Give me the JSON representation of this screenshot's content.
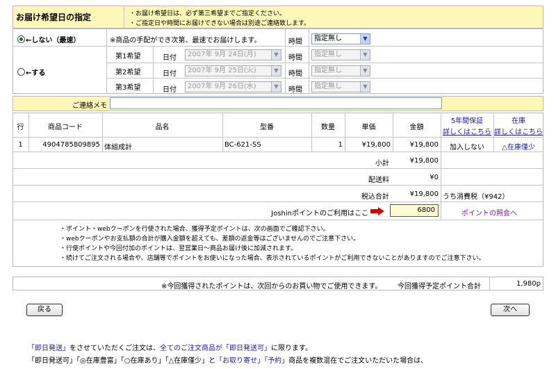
{
  "delivery": {
    "title": "お届け希望日の指定",
    "notes": [
      "・お届け希望日は、必ず第三希望までご指定ください。",
      "・ご指定日や時間にお届けできない場合は別途ご連絡致します。"
    ],
    "option_fastest_label": "←しない（最速）",
    "option_fastest_note": "※商品の手配ができ次第、最速でお届けします。",
    "option_specify_label": "←する",
    "time_label": "時間",
    "time_default": "指定無し",
    "date_label": "日付",
    "wishes": [
      {
        "label": "第1希望",
        "date": "2007年 9月 24日(月)"
      },
      {
        "label": "第2希望",
        "date": "2007年 9月 25日(火)"
      },
      {
        "label": "第3希望",
        "date": "2007年 9月 26日(水)"
      }
    ],
    "memo_label": "ご連絡メモ"
  },
  "table": {
    "headers": {
      "row": "行",
      "code": "商品コード",
      "name": "品名",
      "model": "型番",
      "qty": "数量",
      "price": "単価",
      "amount": "金額",
      "warranty_top": "5年間保証",
      "warranty_link": "詳しくはこちら",
      "stock_top": "在庫",
      "stock_link": "詳しくはこちら"
    },
    "row": {
      "no": "1",
      "code": "4904785809895",
      "name": "体組成計",
      "model": "BC-621-SS",
      "qty": "1",
      "price": "¥19,800",
      "amount": "¥19,800",
      "warranty": "加入しない",
      "stock": "△在庫僅少"
    },
    "subtotal_label": "小計",
    "subtotal": "¥19,800",
    "shipping_label": "配送料",
    "shipping": "¥0",
    "total_label": "税込合計",
    "total": "¥19,800",
    "tax_note": "うち消費税（¥942）",
    "points_label": "Joshinポイントのご利用はここ",
    "points_value": "6800",
    "points_link": "ポイントの照会へ"
  },
  "point_notes": [
    "・ポイント・webクーポンを行使された場合、獲得予定ポイントは、次の画面でご確認下さい。",
    "・webクーポンやお支払額の合計が購入金額を超えても、差額の返金等はございませんのでご注意下さい。",
    "・行使ポイントや今回付加のポイントは、翌営業日～商品お届け後に加減されます。",
    "・続けてご注文される場合や、店舗等でポイントをお使いになった場合、表示されているポイントがご利用できないことがありますのでご注意下さい。"
  ],
  "summary": {
    "note": "※今回獲得されたポイントは、次回からのお買い物でご使用できます。",
    "label": "今回獲得予定ポイント合計",
    "value": "1,980p"
  },
  "buttons": {
    "back": "戻る",
    "next": "次へ"
  },
  "footer": {
    "line1_parts": [
      "「即日発送」",
      "をさせていただくご注文は、",
      "全てのご注文商品が「即日発送可」",
      "に限ります。"
    ],
    "line2_parts": [
      "「即日発送可」「◎在庫豊富」「○在庫あり」「△在庫僅少」と",
      "「お取り寄せ」「予約」",
      "商品を複数混在でご注文いただいた場合は、"
    ]
  }
}
